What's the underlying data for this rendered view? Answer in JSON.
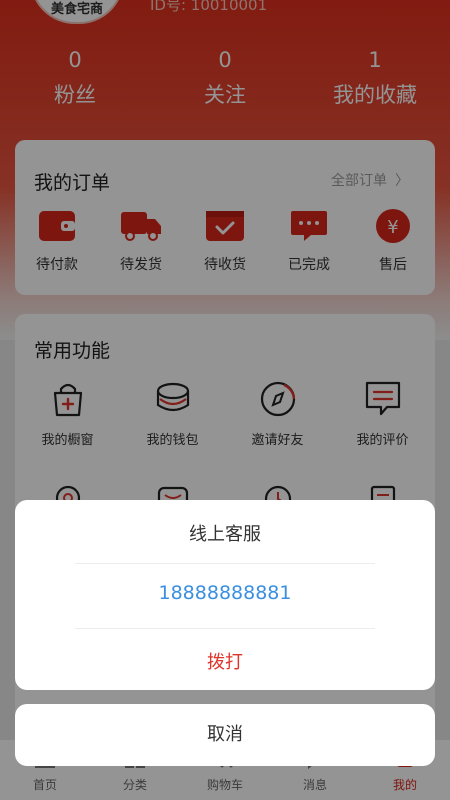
{
  "profile": {
    "avatar_text": "美食宅商",
    "user_id_partial": "ID号: 10010001"
  },
  "stats": [
    {
      "count": "0",
      "label": "粉丝"
    },
    {
      "count": "0",
      "label": "关注"
    },
    {
      "count": "1",
      "label": "我的收藏"
    }
  ],
  "orders": {
    "title": "我的订单",
    "all_label": "全部订单",
    "items": [
      {
        "label": "待付款",
        "icon": "wallet-icon"
      },
      {
        "label": "待发货",
        "icon": "truck-icon"
      },
      {
        "label": "待收货",
        "icon": "package-check-icon"
      },
      {
        "label": "已完成",
        "icon": "chat-bubble-icon"
      },
      {
        "label": "售后",
        "icon": "yen-circle-icon"
      }
    ]
  },
  "common": {
    "title": "常用功能",
    "items": [
      {
        "label": "我的橱窗",
        "icon": "shopping-bag-icon"
      },
      {
        "label": "我的钱包",
        "icon": "coin-stack-icon"
      },
      {
        "label": "邀请好友",
        "icon": "compass-icon"
      },
      {
        "label": "我的评价",
        "icon": "comment-icon"
      }
    ]
  },
  "tabbar": [
    {
      "label": "首页",
      "icon": "home-icon"
    },
    {
      "label": "分类",
      "icon": "category-icon"
    },
    {
      "label": "购物车",
      "icon": "cart-icon"
    },
    {
      "label": "消息",
      "icon": "message-icon"
    },
    {
      "label": "我的",
      "icon": "profile-icon",
      "active": true
    }
  ],
  "dialog": {
    "title": "线上客服",
    "phone": "18888888881",
    "call_label": "拨打",
    "cancel_label": "取消"
  },
  "colors": {
    "brand_red": "#d9261c",
    "phone_blue": "#3a8fe0"
  }
}
